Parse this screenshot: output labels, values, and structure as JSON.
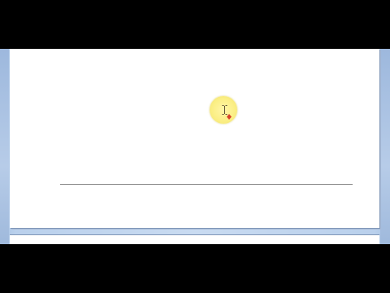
{
  "document": {
    "has_horizontal_rule": true
  },
  "cursor": {
    "type": "i-beam",
    "highlight_color": "#fbef86",
    "click_marker_color": "#d8432a"
  },
  "colors": {
    "workspace": "#c9dbf1",
    "page": "#ffffff",
    "rule": "#8a8a8a",
    "letterbox": "#000000"
  },
  "icons": [
    "i-beam-cursor-icon",
    "click-marker-icon"
  ]
}
